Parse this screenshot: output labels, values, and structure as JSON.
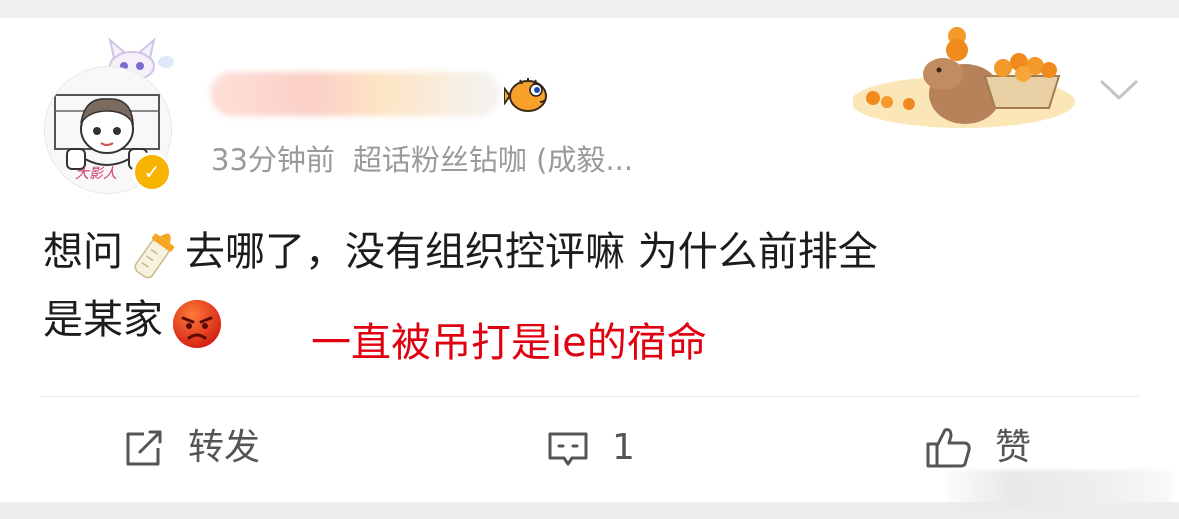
{
  "post": {
    "time": "33分钟前",
    "source": "超话粉丝钻咖 (成毅...",
    "content_line1_a": "想问",
    "content_line1_b": "去哪了，没有组织控评嘛 为什么前排全",
    "content_line2": "是某家",
    "annotation": "一直被吊打是ie的宿命",
    "annotation_color": "#e0000f",
    "avatar_text": "大影人"
  },
  "actions": {
    "repost_label": "转发",
    "comment_count": "1",
    "like_label": "赞"
  },
  "icons": {
    "verified": "verified-badge-icon",
    "fish": "puffer-fish-icon",
    "more": "chevron-down-icon",
    "repost": "repost-icon",
    "comment": "comment-icon",
    "like": "thumbs-up-icon",
    "bottle": "baby-bottle-emoji",
    "angry": "angry-face-emoji"
  }
}
